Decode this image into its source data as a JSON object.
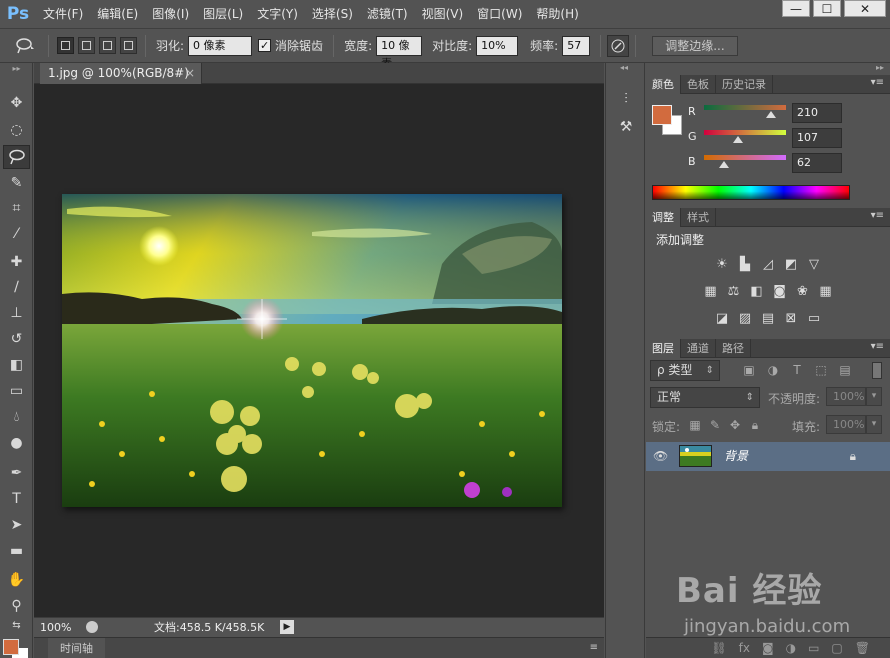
{
  "app": {
    "logo": "Ps"
  },
  "menu": [
    "文件(F)",
    "编辑(E)",
    "图像(I)",
    "图层(L)",
    "文字(Y)",
    "选择(S)",
    "滤镜(T)",
    "视图(V)",
    "窗口(W)",
    "帮助(H)"
  ],
  "window_controls": {
    "minimize": "—",
    "restore": "☐",
    "close": "✕"
  },
  "options": {
    "feather_label": "羽化:",
    "feather_value": "0 像素",
    "antialias_label": "消除锯齿",
    "antialias_checked": "✓",
    "width_label": "宽度:",
    "width_value": "10 像素",
    "contrast_label": "对比度:",
    "contrast_value": "10%",
    "frequency_label": "频率:",
    "frequency_value": "57",
    "refine_edge_label": "调整边缘..."
  },
  "document": {
    "tab_title": "1.jpg @ 100%(RGB/8#) *",
    "tab_close": "×"
  },
  "status": {
    "zoom": "100%",
    "doc_size": "文档:458.5 K/458.5K"
  },
  "timeline": {
    "label": "时间轴"
  },
  "color_panel": {
    "tabs": [
      "颜色",
      "色板",
      "历史记录"
    ],
    "fg_color": "#d26b3e",
    "bg_color": "#ffffff",
    "channels": [
      {
        "name": "R",
        "value": "210",
        "level": 0.82,
        "gradient": "linear-gradient(to right,#0a6b3e,#d26b3e)"
      },
      {
        "name": "G",
        "value": "107",
        "level": 0.42,
        "gradient": "linear-gradient(to right,#d2003e,#d2ff3e)"
      },
      {
        "name": "B",
        "value": "62",
        "level": 0.24,
        "gradient": "linear-gradient(to right,#d26b00,#d26bff)"
      }
    ]
  },
  "adjust_panel": {
    "tabs": [
      "调整",
      "样式"
    ],
    "title": "添加调整"
  },
  "layers_panel": {
    "tabs": [
      "图层",
      "通道",
      "路径"
    ],
    "filter_kind": "ρ 类型",
    "blend_mode": "正常",
    "opacity_label": "不透明度:",
    "opacity_value": "100%",
    "lock_label": "锁定:",
    "fill_label": "填充:",
    "fill_value": "100%",
    "layer_name": "背景"
  },
  "watermark": {
    "big": "Bai 经验",
    "small": "jingyan.baidu.com"
  }
}
